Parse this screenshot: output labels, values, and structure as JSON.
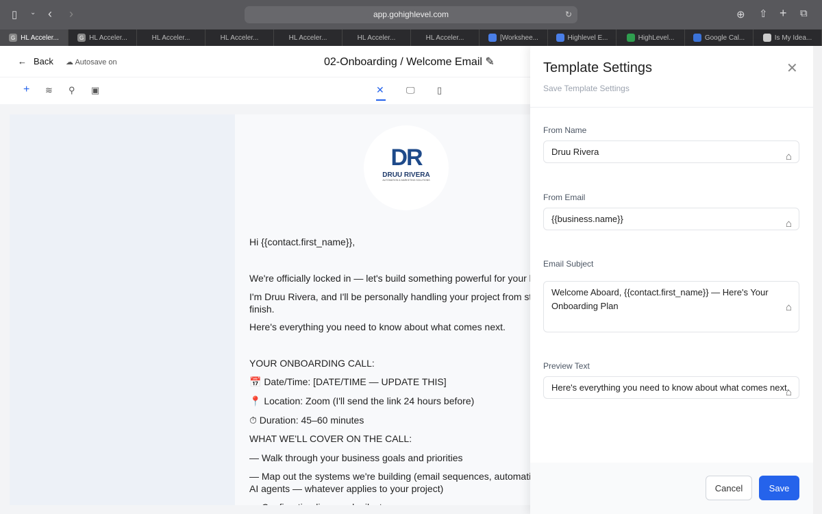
{
  "browser": {
    "url": "app.gohighlevel.com",
    "tabs": [
      {
        "label": "HL Acceler...",
        "icon": "G",
        "active": true
      },
      {
        "label": "HL Acceler...",
        "icon": "G"
      },
      {
        "label": "HL Acceler..."
      },
      {
        "label": "HL Acceler..."
      },
      {
        "label": "HL Acceler..."
      },
      {
        "label": "HL Acceler..."
      },
      {
        "label": "HL Acceler..."
      },
      {
        "label": "[Workshee...",
        "icon": "docs"
      },
      {
        "label": "Highlevel E...",
        "icon": "docs"
      },
      {
        "label": "HighLevel...",
        "icon": "sheets"
      },
      {
        "label": "Google Cal...",
        "icon": "calendar"
      },
      {
        "label": "Is My Idea...",
        "icon": "page"
      }
    ]
  },
  "header": {
    "back": "Back",
    "autosave": "Autosave on",
    "title": "02-Onboarding / Welcome Email"
  },
  "email": {
    "logo_name": "DRUU RIVERA",
    "logo_tagline": "AUTOMATION & MARKETING SOLUTIONS",
    "lines": [
      "Hi {{contact.first_name}},",
      "We're officially locked in — let's build something powerful for your business.",
      "I'm Druu Rivera, and I'll be personally handling your project from start to",
      "finish.",
      "Here's everything you need to know about what comes next.",
      "YOUR ONBOARDING CALL:",
      "📅 Date/Time: [DATE/TIME — UPDATE THIS]",
      "📍 Location: Zoom (I'll send the link 24 hours before)",
      "⏱ Duration: 45–60 minutes",
      "WHAT WE'LL COVER ON THE CALL:",
      "— Walk through your business goals and priorities",
      "— Map out the systems we're building (email sequences, automations,",
      "AI agents — whatever applies to your project)",
      "— Confirm timelines and milestones"
    ]
  },
  "panel": {
    "title": "Template Settings",
    "subtitle": "Save Template Settings",
    "from_name_label": "From Name",
    "from_name": "Druu Rivera",
    "from_email_label": "From Email",
    "from_email": "{{business.name}}",
    "subject_label": "Email Subject",
    "subject": "Welcome Aboard, {{contact.first_name}} — Here's Your Onboarding Plan",
    "preview_label": "Preview Text",
    "preview": "Here's everything you need to know about what comes next.",
    "cancel": "Cancel",
    "save": "Save"
  },
  "colors": {
    "accent": "#2563eb"
  }
}
